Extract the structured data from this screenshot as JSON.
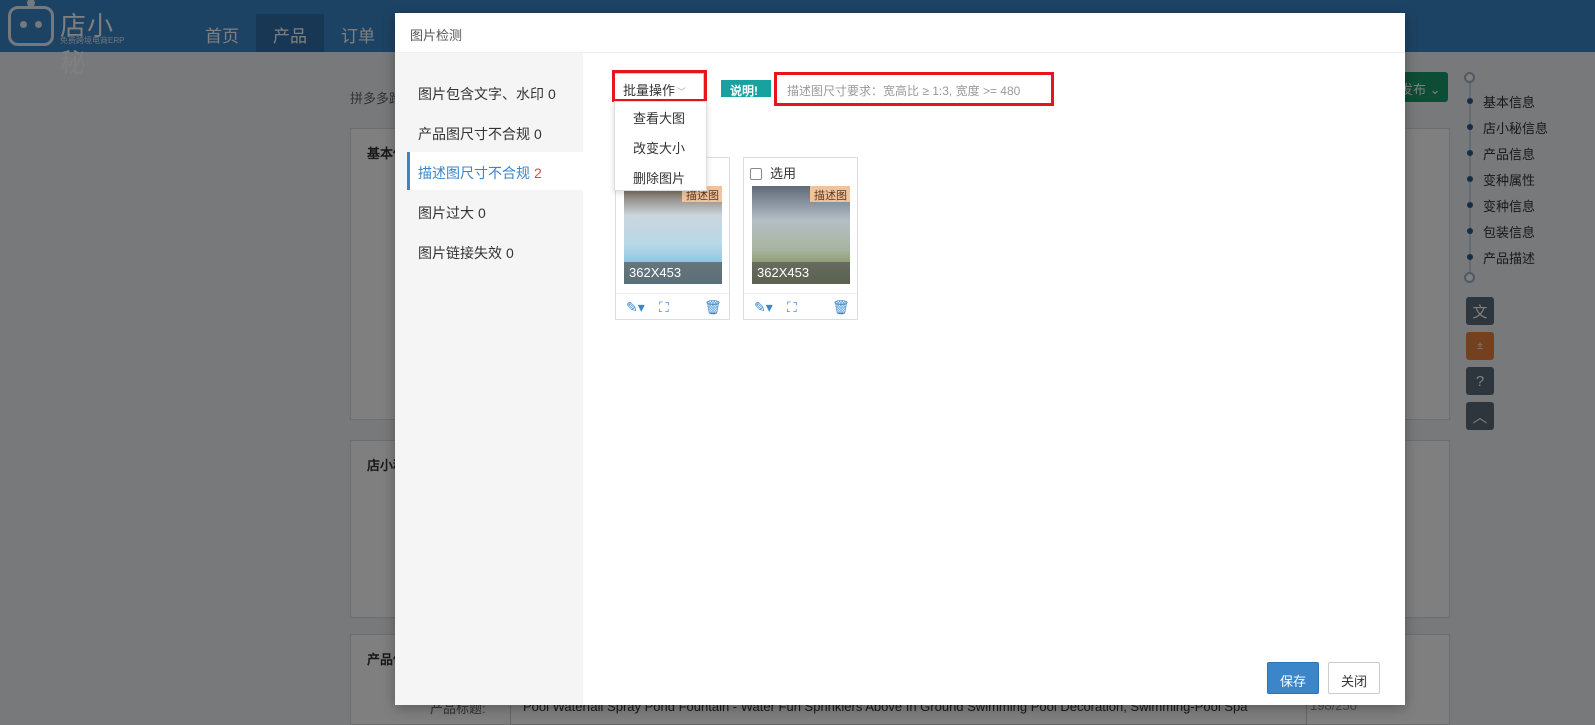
{
  "app": {
    "logo_name": "店小秘",
    "logo_sub": "免费跨境电商ERP",
    "nav": [
      {
        "label": "首页"
      },
      {
        "label": "产品"
      },
      {
        "label": "订单"
      }
    ]
  },
  "background": {
    "breadcrumb": "拼多多跨",
    "publish_button": "发布",
    "panels": [
      {
        "title": "基本信"
      },
      {
        "title": "店小秘"
      },
      {
        "title": "产品信"
      }
    ],
    "title_field": {
      "label": "产品标题:",
      "value": "Pool Waterfall Spray Pond Fountain - Water Fun Sprinklers Above In Ground Swimming Pool Decoration, Swimming-Pool Spa",
      "count": "198/250"
    },
    "side_nav": [
      "基本信息",
      "店小秘信息",
      "产品信息",
      "变种属性",
      "变种信息",
      "包装信息",
      "产品描述"
    ]
  },
  "modal": {
    "title": "图片检测",
    "categories": [
      {
        "label": "图片包含文字、水印",
        "count": "0"
      },
      {
        "label": "产品图尺寸不合规",
        "count": "0"
      },
      {
        "label": "描述图尺寸不合规",
        "count": "2"
      },
      {
        "label": "图片过大",
        "count": "0"
      },
      {
        "label": "图片链接失效",
        "count": "0"
      }
    ],
    "batch_label": "批量操作",
    "dropdown": [
      "查看大图",
      "改变大小",
      "删除图片"
    ],
    "note_badge": "说明!",
    "note_text": "描述图尺寸要求：宽高比 ≥ 1:3, 宽度 >= 480",
    "images": [
      {
        "select_label": "选用",
        "tag": "描述图",
        "dim": "362X453"
      },
      {
        "select_label": "选用",
        "tag": "描述图",
        "dim": "362X453"
      }
    ],
    "save_label": "保存",
    "close_label": "关闭"
  }
}
